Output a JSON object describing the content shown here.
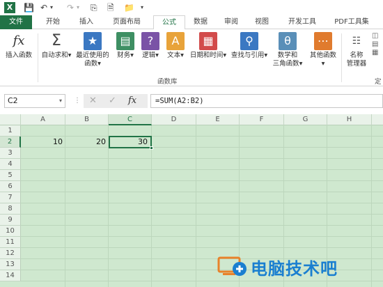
{
  "quick_access": [
    "save",
    "undo",
    "redo",
    "print-preview",
    "new-file",
    "customize"
  ],
  "tabs": [
    {
      "label": "文件",
      "active": false,
      "file": true
    },
    {
      "label": "开始",
      "active": false
    },
    {
      "label": "插入",
      "active": false
    },
    {
      "label": "页面布局",
      "active": false
    },
    {
      "label": "公式",
      "active": true
    },
    {
      "label": "数据",
      "active": false
    },
    {
      "label": "审阅",
      "active": false
    },
    {
      "label": "视图",
      "active": false
    },
    {
      "label": "开发工具",
      "active": false
    },
    {
      "label": "PDF工具集",
      "active": false
    }
  ],
  "ribbon": {
    "insert_function": "插入函数",
    "autosum": "自动求和",
    "recent_l1": "最近使用的",
    "recent_l2": "函数",
    "financial": "财务",
    "logical": "逻辑",
    "text": "文本",
    "datetime": "日期和时间",
    "lookup": "查找与引用",
    "math_l1": "数学和",
    "math_l2": "三角函数",
    "more": "其他函数",
    "group_label": "函数库",
    "name_mgr_l1": "名称",
    "name_mgr_l2": "管理器",
    "define_partial": "定"
  },
  "formula_bar": {
    "name_box": "C2",
    "fx_label": "fx",
    "formula": "=SUM(A2:B2)"
  },
  "sheet": {
    "columns": [
      "A",
      "B",
      "C",
      "D",
      "E",
      "F",
      "G",
      "H"
    ],
    "rows": [
      "1",
      "2",
      "3",
      "4",
      "5",
      "6",
      "7",
      "8",
      "9",
      "10",
      "11",
      "12",
      "13",
      "14"
    ],
    "cells": {
      "A2": "10",
      "B2": "20",
      "C2": "30"
    },
    "selected": "C2"
  },
  "watermark": "电脑技术吧",
  "colors": {
    "accent": "#217346",
    "sheet_bg": "#cfe8cf"
  }
}
